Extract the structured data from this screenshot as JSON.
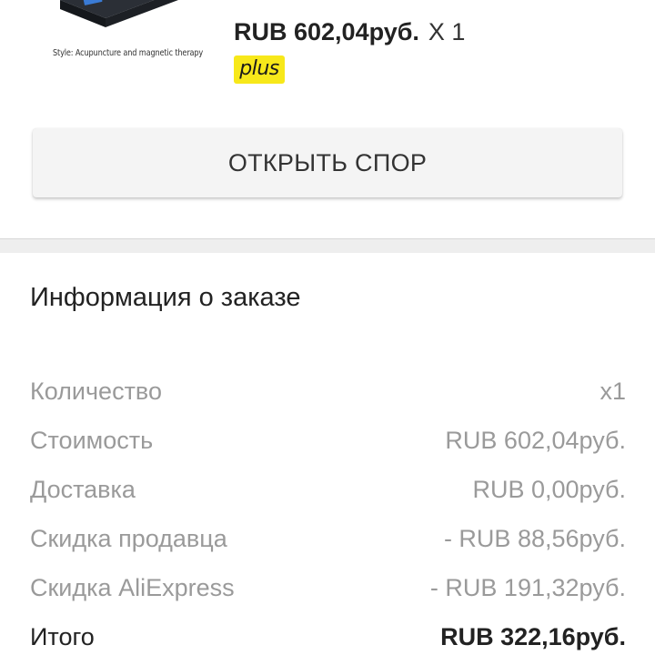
{
  "product": {
    "style_text": "Style: Acupuncture and magnetic therapy",
    "price": "RUB 602,04руб.",
    "quantity": "X 1",
    "badge": "plus",
    "image_icon": "product-device-icon"
  },
  "actions": {
    "dispute_label": "ОТКРЫТЬ СПОР"
  },
  "order_info": {
    "title": "Информация о заказе",
    "rows": [
      {
        "label": "Количество",
        "value": "x1"
      },
      {
        "label": "Стоимость",
        "value": "RUB 602,04руб."
      },
      {
        "label": "Доставка",
        "value": "RUB 0,00руб."
      },
      {
        "label": "Скидка продавца",
        "value": "- RUB 88,56руб."
      },
      {
        "label": "Скидка AliExpress",
        "value": "- RUB 191,32руб."
      }
    ],
    "total": {
      "label": "Итого",
      "value": "RUB 322,16руб."
    }
  },
  "colors": {
    "badge_yellow": "#f7e81a",
    "button_bg": "#f4f4f4",
    "muted_text": "#9a9a9a",
    "dark_text": "#222222",
    "separator": "#eeeeee"
  }
}
